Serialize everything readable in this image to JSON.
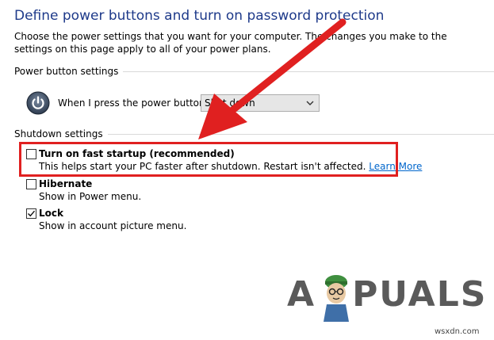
{
  "title": "Define power buttons and turn on password protection",
  "description": "Choose the power settings that you want for your computer. The changes you make to the settings on this page apply to all of your power plans.",
  "power_button_group": {
    "label": "Power button settings",
    "when_pressed_label": "When I press the power button:",
    "select_value": "Shut down"
  },
  "shutdown_group": {
    "label": "Shutdown settings",
    "options": [
      {
        "label": "Turn on fast startup (recommended)",
        "description": "This helps start your PC faster after shutdown. Restart isn't affected.",
        "link": "Learn More",
        "checked": false
      },
      {
        "label": "Hibernate",
        "description": "Show in Power menu.",
        "checked": false
      },
      {
        "label": "Lock",
        "description": "Show in account picture menu.",
        "checked": true
      }
    ]
  },
  "watermark": {
    "left": "A",
    "right": "PUALS"
  },
  "site": "wsxdn.com",
  "colors": {
    "title": "#1e3a8a",
    "link": "#0066cc",
    "highlight": "#e02020",
    "arrow": "#e02020"
  }
}
